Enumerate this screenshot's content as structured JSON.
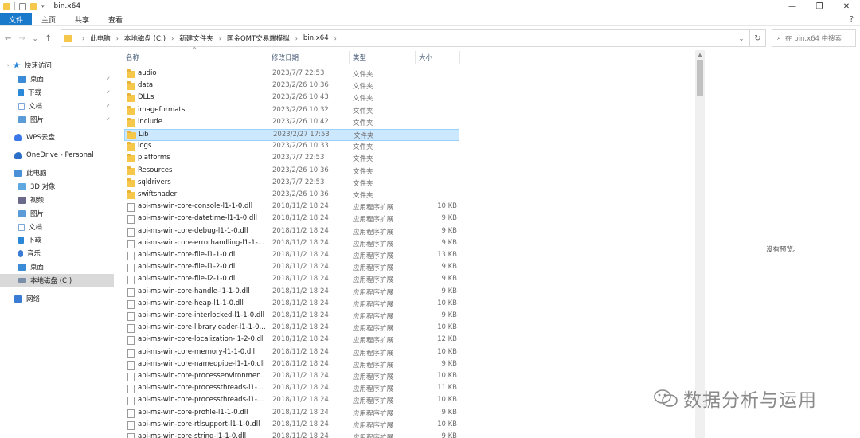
{
  "window": {
    "title": "bin.x64",
    "controls": [
      "—",
      "❐",
      "✕"
    ]
  },
  "ribbon": {
    "tabs": [
      "文件",
      "主页",
      "共享",
      "查看"
    ],
    "help": "?"
  },
  "nav_buttons": {
    "back": "←",
    "forward": "→",
    "recent": "⌄",
    "up": "↑"
  },
  "address": {
    "crumbs": [
      "此电脑",
      "本地磁盘 (C:)",
      "新建文件夹",
      "国金QMT交易端模拟",
      "bin.x64"
    ],
    "dropdown": "⌄",
    "refresh": "↻"
  },
  "search": {
    "placeholder": "在 bin.x64 中搜索",
    "icon": "search-icon"
  },
  "navpane": {
    "items": [
      {
        "label": "快速访问",
        "icon": "star-icon",
        "color": "#2b88d8"
      },
      {
        "label": "桌面",
        "icon": "desktop-icon",
        "color": "#3a8bd8",
        "pinned": true
      },
      {
        "label": "下载",
        "icon": "download-icon",
        "color": "#2b88d8",
        "pinned": true
      },
      {
        "label": "文档",
        "icon": "document-icon",
        "color": "#7aa7d8",
        "pinned": true
      },
      {
        "label": "图片",
        "icon": "picture-icon",
        "color": "#5a9bd8",
        "pinned": true
      },
      {
        "label": "WPS云盘",
        "icon": "cloud-icon",
        "color": "#3b78e7"
      },
      {
        "label": "OneDrive - Personal",
        "icon": "onedrive-icon",
        "color": "#2b6fc8"
      },
      {
        "label": "此电脑",
        "icon": "computer-icon",
        "color": "#4a90d9"
      },
      {
        "label": "3D 对象",
        "icon": "cube-icon",
        "color": "#5fa8e0"
      },
      {
        "label": "视频",
        "icon": "video-icon",
        "color": "#6a6a8a"
      },
      {
        "label": "图片",
        "icon": "picture-icon",
        "color": "#5a9bd8"
      },
      {
        "label": "文档",
        "icon": "document-icon",
        "color": "#7aa7d8"
      },
      {
        "label": "下载",
        "icon": "download-icon",
        "color": "#2b88d8"
      },
      {
        "label": "音乐",
        "icon": "music-icon",
        "color": "#3a7bd5"
      },
      {
        "label": "桌面",
        "icon": "desktop-icon",
        "color": "#3a8bd8"
      },
      {
        "label": "本地磁盘 (C:)",
        "icon": "drive-icon",
        "color": "#7a8ea8",
        "selected": true
      },
      {
        "label": "网络",
        "icon": "network-icon",
        "color": "#3a7bd5"
      }
    ]
  },
  "columns": {
    "name": "名称",
    "date": "修改日期",
    "type": "类型",
    "size": "大小",
    "sort_arrow": "^"
  },
  "files": [
    {
      "name": "audio",
      "date": "2023/7/7 22:53",
      "type": "文件夹",
      "size": "",
      "kind": "folder"
    },
    {
      "name": "data",
      "date": "2023/2/26 10:36",
      "type": "文件夹",
      "size": "",
      "kind": "folder"
    },
    {
      "name": "DLLs",
      "date": "2023/2/26 10:43",
      "type": "文件夹",
      "size": "",
      "kind": "folder"
    },
    {
      "name": "imageformats",
      "date": "2023/2/26 10:32",
      "type": "文件夹",
      "size": "",
      "kind": "folder"
    },
    {
      "name": "include",
      "date": "2023/2/26 10:42",
      "type": "文件夹",
      "size": "",
      "kind": "folder"
    },
    {
      "name": "Lib",
      "date": "2023/2/27 17:53",
      "type": "文件夹",
      "size": "",
      "kind": "folder",
      "selected": true
    },
    {
      "name": "logs",
      "date": "2023/2/26 10:33",
      "type": "文件夹",
      "size": "",
      "kind": "folder"
    },
    {
      "name": "platforms",
      "date": "2023/7/7 22:53",
      "type": "文件夹",
      "size": "",
      "kind": "folder"
    },
    {
      "name": "Resources",
      "date": "2023/2/26 10:36",
      "type": "文件夹",
      "size": "",
      "kind": "folder"
    },
    {
      "name": "sqldrivers",
      "date": "2023/7/7 22:53",
      "type": "文件夹",
      "size": "",
      "kind": "folder"
    },
    {
      "name": "swiftshader",
      "date": "2023/2/26 10:36",
      "type": "文件夹",
      "size": "",
      "kind": "folder"
    },
    {
      "name": "api-ms-win-core-console-l1-1-0.dll",
      "date": "2018/11/2 18:24",
      "type": "应用程序扩展",
      "size": "10 KB",
      "kind": "dll"
    },
    {
      "name": "api-ms-win-core-datetime-l1-1-0.dll",
      "date": "2018/11/2 18:24",
      "type": "应用程序扩展",
      "size": "9 KB",
      "kind": "dll"
    },
    {
      "name": "api-ms-win-core-debug-l1-1-0.dll",
      "date": "2018/11/2 18:24",
      "type": "应用程序扩展",
      "size": "9 KB",
      "kind": "dll"
    },
    {
      "name": "api-ms-win-core-errorhandling-l1-1-...",
      "date": "2018/11/2 18:24",
      "type": "应用程序扩展",
      "size": "9 KB",
      "kind": "dll"
    },
    {
      "name": "api-ms-win-core-file-l1-1-0.dll",
      "date": "2018/11/2 18:24",
      "type": "应用程序扩展",
      "size": "13 KB",
      "kind": "dll"
    },
    {
      "name": "api-ms-win-core-file-l1-2-0.dll",
      "date": "2018/11/2 18:24",
      "type": "应用程序扩展",
      "size": "9 KB",
      "kind": "dll"
    },
    {
      "name": "api-ms-win-core-file-l2-1-0.dll",
      "date": "2018/11/2 18:24",
      "type": "应用程序扩展",
      "size": "9 KB",
      "kind": "dll"
    },
    {
      "name": "api-ms-win-core-handle-l1-1-0.dll",
      "date": "2018/11/2 18:24",
      "type": "应用程序扩展",
      "size": "9 KB",
      "kind": "dll"
    },
    {
      "name": "api-ms-win-core-heap-l1-1-0.dll",
      "date": "2018/11/2 18:24",
      "type": "应用程序扩展",
      "size": "10 KB",
      "kind": "dll"
    },
    {
      "name": "api-ms-win-core-interlocked-l1-1-0.dll",
      "date": "2018/11/2 18:24",
      "type": "应用程序扩展",
      "size": "9 KB",
      "kind": "dll"
    },
    {
      "name": "api-ms-win-core-libraryloader-l1-1-0...",
      "date": "2018/11/2 18:24",
      "type": "应用程序扩展",
      "size": "10 KB",
      "kind": "dll"
    },
    {
      "name": "api-ms-win-core-localization-l1-2-0.dll",
      "date": "2018/11/2 18:24",
      "type": "应用程序扩展",
      "size": "12 KB",
      "kind": "dll"
    },
    {
      "name": "api-ms-win-core-memory-l1-1-0.dll",
      "date": "2018/11/2 18:24",
      "type": "应用程序扩展",
      "size": "10 KB",
      "kind": "dll"
    },
    {
      "name": "api-ms-win-core-namedpipe-l1-1-0.dll",
      "date": "2018/11/2 18:24",
      "type": "应用程序扩展",
      "size": "9 KB",
      "kind": "dll"
    },
    {
      "name": "api-ms-win-core-processenvironmen...",
      "date": "2018/11/2 18:24",
      "type": "应用程序扩展",
      "size": "10 KB",
      "kind": "dll"
    },
    {
      "name": "api-ms-win-core-processthreads-l1-...",
      "date": "2018/11/2 18:24",
      "type": "应用程序扩展",
      "size": "11 KB",
      "kind": "dll"
    },
    {
      "name": "api-ms-win-core-processthreads-l1-...",
      "date": "2018/11/2 18:24",
      "type": "应用程序扩展",
      "size": "10 KB",
      "kind": "dll"
    },
    {
      "name": "api-ms-win-core-profile-l1-1-0.dll",
      "date": "2018/11/2 18:24",
      "type": "应用程序扩展",
      "size": "9 KB",
      "kind": "dll"
    },
    {
      "name": "api-ms-win-core-rtlsupport-l1-1-0.dll",
      "date": "2018/11/2 18:24",
      "type": "应用程序扩展",
      "size": "10 KB",
      "kind": "dll"
    },
    {
      "name": "api-ms-win-core-string-l1-1-0.dll",
      "date": "2018/11/2 18:24",
      "type": "应用程序扩展",
      "size": "9 KB",
      "kind": "dll"
    }
  ],
  "preview": {
    "text": "没有预览。"
  },
  "watermark": {
    "text": "数据分析与运用"
  },
  "colors": {
    "accent": "#1979ca",
    "selection": "#cce8ff",
    "folder": "#f5c84c"
  }
}
